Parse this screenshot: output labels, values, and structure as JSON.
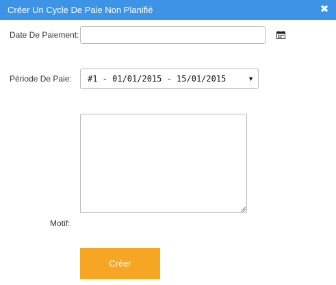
{
  "dialog": {
    "title": "Créer Un Cycle De Paie Non Planifié",
    "close_icon": "close-icon",
    "header_color": "#3d94e6"
  },
  "form": {
    "date_label": "Date De Paiement:",
    "date_value": "",
    "date_placeholder": "",
    "calendar_icon": "calendar-icon",
    "periode_label": "Période De Paie:",
    "periode_selected": "#1 - 01/01/2015 - 15/01/2015",
    "motif_label": "Motif:",
    "motif_value": ""
  },
  "actions": {
    "create_label": "Créer",
    "create_color": "#f6a623"
  }
}
